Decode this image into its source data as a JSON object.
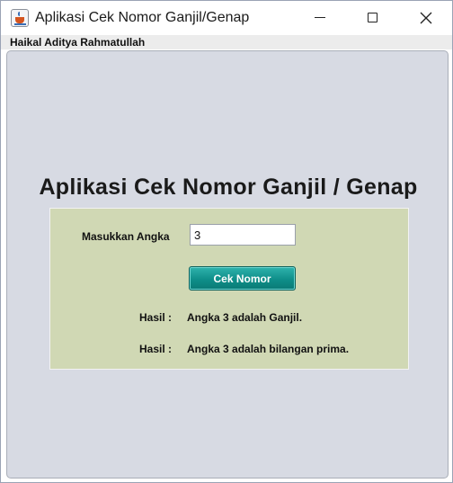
{
  "window": {
    "title": "Aplikasi Cek Nomor Ganjil/Genap",
    "icon": "java-cup-icon",
    "controls": [
      "minimize-icon",
      "maximize-icon",
      "close-icon"
    ]
  },
  "menubar": {
    "label": "Haikal Aditya Rahmatullah"
  },
  "main": {
    "heading": "Aplikasi Cek Nomor Ganjil / Genap",
    "form": {
      "input_label": "Masukkan Angka",
      "input_value": "3",
      "button_label": "Cek Nomor",
      "results": [
        {
          "label": "Hasil :",
          "value": "Angka 3 adalah Ganjil."
        },
        {
          "label": "Hasil :",
          "value": "Angka 3 adalah bilangan prima."
        }
      ]
    }
  },
  "colors": {
    "panel_background": "#d7dae3",
    "form_background": "#d0d8b4",
    "button_accent": "#0e8e89"
  }
}
